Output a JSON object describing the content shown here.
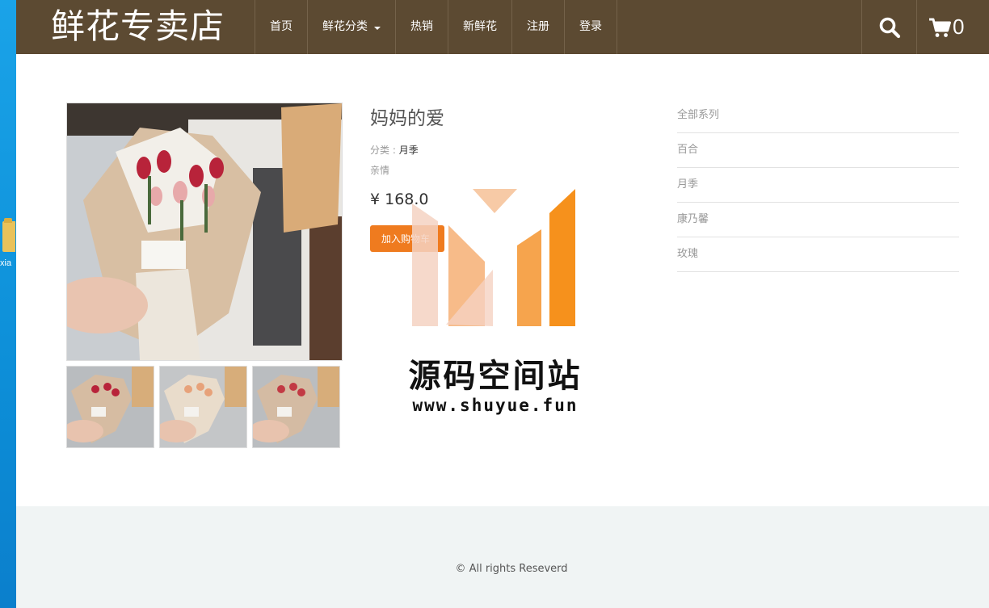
{
  "desktop": {
    "icon_label": "xia"
  },
  "header": {
    "brand": "鲜花专卖店",
    "nav": {
      "home": "首页",
      "categories": "鲜花分类",
      "hot": "热销",
      "new": "新鲜花",
      "register": "注册",
      "login": "登录"
    },
    "search_icon": "search-icon",
    "cart_icon": "cart-icon",
    "cart_count": "0"
  },
  "product": {
    "name": "妈妈的爱",
    "category_label": "分类 :",
    "category_value": "月季",
    "tag": "亲情",
    "price": "¥ 168.0",
    "buy_button": "加入购物车",
    "thumbnail_count": 3
  },
  "sidebar": {
    "items": [
      "全部系列",
      "百合",
      "月季",
      "康乃馨",
      "玫瑰"
    ]
  },
  "watermark": {
    "text": "源码空间站",
    "url": "www.shuyue.fun",
    "colors": [
      "#f5d2c2",
      "#f6b47c",
      "#f59a3a",
      "#f58b10"
    ]
  },
  "footer": {
    "copyright": "© All rights Reseverd"
  },
  "colors": {
    "header_bg": "#5c4a32",
    "accent": "#ef7b1f",
    "footer_bg": "#f0f4f4"
  }
}
